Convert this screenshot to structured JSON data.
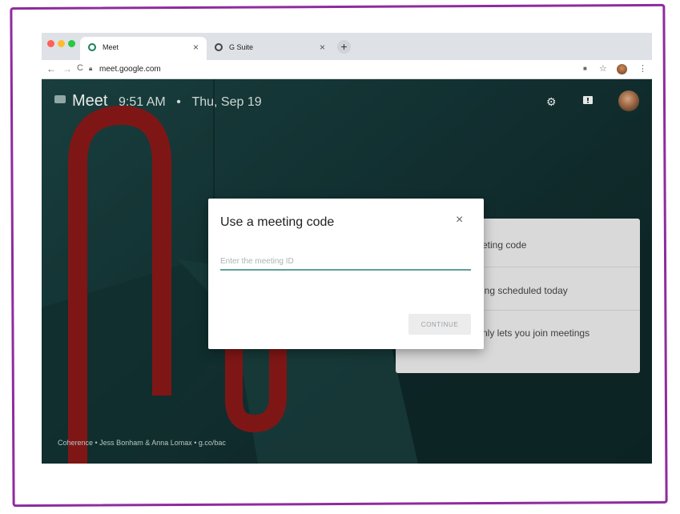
{
  "browser": {
    "tabs": [
      {
        "label": "Meet",
        "active": true,
        "icon": "meet-icon"
      },
      {
        "label": "G Suite",
        "active": false,
        "icon": "gsuite-icon"
      }
    ],
    "url": "meet.google.com"
  },
  "meet": {
    "app_name": "Meet",
    "time": "9:51 AM",
    "separator": "•",
    "date": "Thu, Sep 19",
    "caption": "Coherence • Jess Bonham & Anna Lomax • g.co/bac"
  },
  "card": {
    "rows": [
      "eting code",
      "ing scheduled today",
      "nly lets you join meetings"
    ]
  },
  "dialog": {
    "title": "Use a meeting code",
    "close_glyph": "×",
    "input_placeholder": "Enter the meeting ID",
    "input_value": "",
    "continue_label": "CONTINUE"
  },
  "colors": {
    "frame": "#8e2c9e",
    "input_underline": "#5f9f97",
    "background_teal": "#1a3a3a",
    "sculpture_red": "#9b1c1c"
  }
}
